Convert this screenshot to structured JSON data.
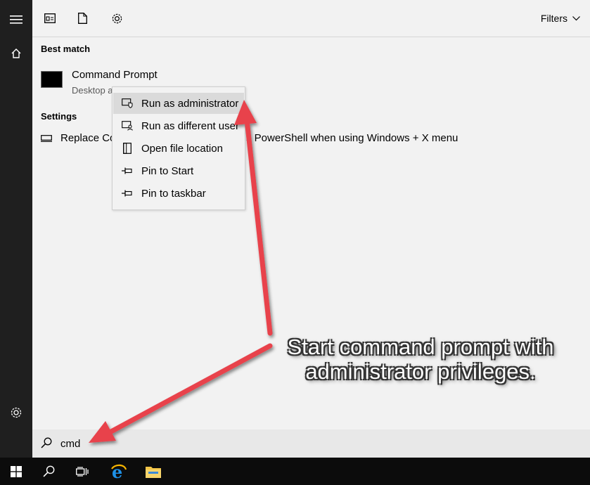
{
  "sidebar": {
    "icons": [
      "hamburger-menu-icon",
      "home-icon",
      "settings-gear-icon"
    ]
  },
  "toolbar": {
    "icons": [
      "apps-icon",
      "documents-icon",
      "settings-icon"
    ],
    "filters_label": "Filters"
  },
  "best_match": {
    "heading": "Best match",
    "title": "Command Prompt",
    "subtitle": "Desktop a"
  },
  "settings_section": {
    "heading": "Settings",
    "item_left": "Replace Co",
    "item_right": "s PowerShell when using Windows + X menu"
  },
  "context_menu": {
    "items": [
      {
        "label": "Run as administrator",
        "icon": "shield-run-icon",
        "highlighted": true
      },
      {
        "label": "Run as different user",
        "icon": "user-run-icon",
        "highlighted": false
      },
      {
        "label": "Open file location",
        "icon": "file-location-icon",
        "highlighted": false
      },
      {
        "label": "Pin to Start",
        "icon": "pin-icon",
        "highlighted": false
      },
      {
        "label": "Pin to taskbar",
        "icon": "pin-icon",
        "highlighted": false
      }
    ]
  },
  "search": {
    "query": "cmd"
  },
  "taskbar": {
    "icons": [
      "windows-start-icon",
      "search-icon",
      "task-view-icon",
      "edge-browser-icon",
      "file-explorer-icon"
    ]
  },
  "annotation": {
    "line1": "Start command prompt with",
    "line2": "administrator privileges."
  },
  "colors": {
    "arrow": "#e8424c",
    "panel_bg": "#f2f2f2",
    "sidebar_bg": "#1f1f1f",
    "taskbar_bg": "#0c0c0c"
  }
}
